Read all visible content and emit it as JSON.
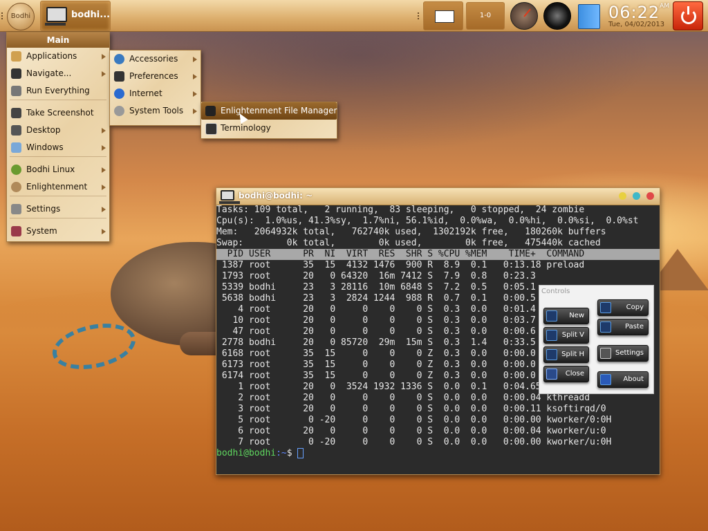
{
  "shelf": {
    "start_label": "Bodhi",
    "task_label": "bodhi...",
    "pager_label": "1-0",
    "clock_time": "06:22",
    "clock_ampm": "AM",
    "clock_date": "Tue, 04/02/2013"
  },
  "main_menu": {
    "title": "Main",
    "items": [
      {
        "label": "Applications",
        "icon": "applications-icon",
        "submenu": true
      },
      {
        "label": "Navigate...",
        "icon": "navigate-icon",
        "submenu": true
      },
      {
        "label": "Run Everything",
        "icon": "run-icon",
        "submenu": false
      },
      {
        "label": "Take Screenshot",
        "icon": "camera-icon",
        "submenu": false
      },
      {
        "label": "Desktop",
        "icon": "desktop-icon",
        "submenu": true
      },
      {
        "label": "Windows",
        "icon": "windows-icon",
        "submenu": true
      },
      {
        "label": "Bodhi Linux",
        "icon": "bodhi-icon",
        "submenu": true
      },
      {
        "label": "Enlightenment",
        "icon": "enlightenment-icon",
        "submenu": true
      },
      {
        "label": "Settings",
        "icon": "settings-icon",
        "submenu": true
      },
      {
        "label": "System",
        "icon": "system-icon",
        "submenu": true
      }
    ]
  },
  "apps_menu": {
    "items": [
      {
        "label": "Accessories"
      },
      {
        "label": "Preferences"
      },
      {
        "label": "Internet"
      },
      {
        "label": "System Tools"
      }
    ]
  },
  "tools_menu": {
    "items": [
      {
        "label": "Enlightenment File Manager"
      },
      {
        "label": "Terminology"
      }
    ]
  },
  "terminal": {
    "title": "bodhi@bodhi: ~",
    "lines": [
      "Tasks: 109 total,   2 running,  83 sleeping,   0 stopped,  24 zombie",
      "Cpu(s):  1.0%us, 41.3%sy,  1.7%ni, 56.1%id,  0.0%wa,  0.0%hi,  0.0%si,  0.0%st",
      "Mem:   2064932k total,   762740k used,  1302192k free,   180260k buffers",
      "Swap:        0k total,        0k used,        0k free,   475440k cached",
      ""
    ],
    "header": "  PID USER      PR  NI  VIRT  RES  SHR S %CPU %MEM    TIME+  COMMAND          ",
    "rows": [
      " 1387 root      35  15  4132 1476  900 R  8.9  0.1   0:13.18 preload",
      " 1793 root      20   0 64320  16m 7412 S  7.9  0.8   0:23.3",
      " 5339 bodhi     23   3 28116  10m 6848 S  7.2  0.5   0:05.1",
      " 5638 bodhi     23   3  2824 1244  988 R  0.7  0.1   0:00.5",
      "    4 root      20   0     0    0    0 S  0.3  0.0   0:01.4",
      "   10 root      20   0     0    0    0 S  0.3  0.0   0:03.7",
      "   47 root      20   0     0    0    0 S  0.3  0.0   0:00.6",
      " 2778 bodhi     20   0 85720  29m  15m S  0.3  1.4   0:33.5",
      " 6168 root      35  15     0    0    0 Z  0.3  0.0   0:00.0",
      " 6173 root      35  15     0    0    0 Z  0.3  0.0   0:00.0",
      " 6174 root      35  15     0    0    0 Z  0.3  0.0   0:00.0",
      "    1 root      20   0  3524 1932 1336 S  0.0  0.1   0:04.65 init",
      "    2 root      20   0     0    0    0 S  0.0  0.0   0:00.04 kthreadd",
      "    3 root      20   0     0    0    0 S  0.0  0.0   0:00.11 ksoftirqd/0",
      "    5 root       0 -20     0    0    0 S  0.0  0.0   0:00.00 kworker/0:0H",
      "    6 root      20   0     0    0    0 S  0.0  0.0   0:00.04 kworker/u:0",
      "    7 root       0 -20     0    0    0 S  0.0  0.0   0:00.00 kworker/u:0H"
    ],
    "prompt_user": "bodhi@bodhi",
    "prompt_path": ":~",
    "prompt_symbol": "$ "
  },
  "controls": {
    "caption": "Controls",
    "new": "New",
    "split_v": "Split V",
    "split_h": "Split H",
    "close": "Close",
    "copy": "Copy",
    "paste": "Paste",
    "settings": "Settings",
    "about": "About"
  },
  "colors": {
    "accent": "#8e6330",
    "power": "#e03a1a",
    "terminal_bg": "#2b2b2b",
    "prompt_user": "#5fd75f"
  }
}
